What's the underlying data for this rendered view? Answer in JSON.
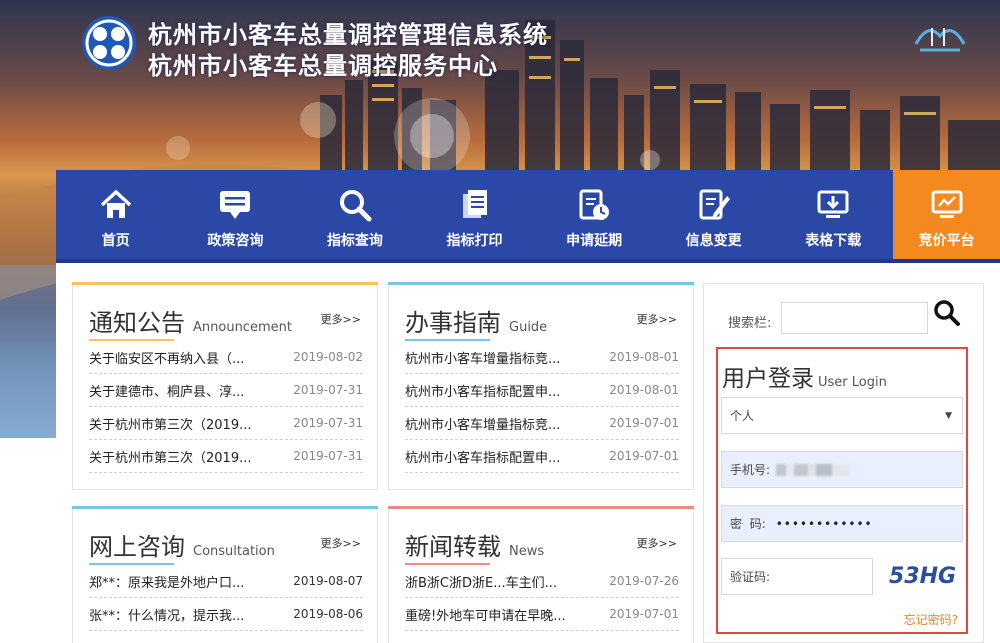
{
  "header": {
    "title_line1": "杭州市小客车总量调控管理信息系统",
    "title_line2": "杭州市小客车总量调控服务中心"
  },
  "nav": {
    "items": [
      {
        "label": "首页",
        "icon": "home-icon"
      },
      {
        "label": "政策咨询",
        "icon": "message-icon"
      },
      {
        "label": "指标查询",
        "icon": "search-icon"
      },
      {
        "label": "指标打印",
        "icon": "document-icon"
      },
      {
        "label": "申请延期",
        "icon": "calendar-clock-icon"
      },
      {
        "label": "信息变更",
        "icon": "edit-document-icon"
      },
      {
        "label": "表格下载",
        "icon": "download-icon"
      },
      {
        "label": "竞价平台",
        "icon": "monitor-icon"
      }
    ],
    "active_color": "#f4891f",
    "bar_color": "#2c48a6"
  },
  "panels": {
    "announcement": {
      "title": "通知公告",
      "title_en": "Announcement",
      "more": "更多>>",
      "items": [
        {
          "text": "关于临安区不再纳入县（...",
          "date": "2019-08-02"
        },
        {
          "text": "关于建德市、桐庐县、淳...",
          "date": "2019-07-31"
        },
        {
          "text": "关于杭州市第三次（2019...",
          "date": "2019-07-31"
        },
        {
          "text": "关于杭州市第三次（2019...",
          "date": "2019-07-31"
        }
      ]
    },
    "guide": {
      "title": "办事指南",
      "title_en": "Guide",
      "more": "更多>>",
      "items": [
        {
          "text": "杭州市小客车增量指标竞...",
          "date": "2019-08-01"
        },
        {
          "text": "杭州市小客车指标配置申...",
          "date": "2019-08-01"
        },
        {
          "text": "杭州市小客车增量指标竞...",
          "date": "2019-07-01"
        },
        {
          "text": "杭州市小客车指标配置申...",
          "date": "2019-07-01"
        }
      ]
    },
    "consultation": {
      "title": "网上咨询",
      "title_en": "Consultation",
      "more": "更多>>",
      "items": [
        {
          "text": "郑**：原来我是外地户口...",
          "date": "2019-08-07"
        },
        {
          "text": "张**：什么情况，提示我...",
          "date": "2019-08-06"
        }
      ]
    },
    "news": {
      "title": "新闻转载",
      "title_en": "News",
      "more": "更多>>",
      "items": [
        {
          "text": "浙B浙C浙D浙E...车主们...",
          "date": "2019-07-26"
        },
        {
          "text": "重磅!外地车可申请在早晚...",
          "date": "2019-07-01"
        }
      ]
    }
  },
  "search": {
    "label": "搜索栏:",
    "placeholder": ""
  },
  "login": {
    "title": "用户登录",
    "title_en": "User Login",
    "account_type": "个人",
    "phone_label": "手机号:",
    "password_label": "密  码:",
    "password_value": "••••••••••••",
    "captcha_label": "验证码:",
    "captcha_text": "53HG",
    "forgot": "忘记密码?",
    "border_color": "#e24646"
  }
}
